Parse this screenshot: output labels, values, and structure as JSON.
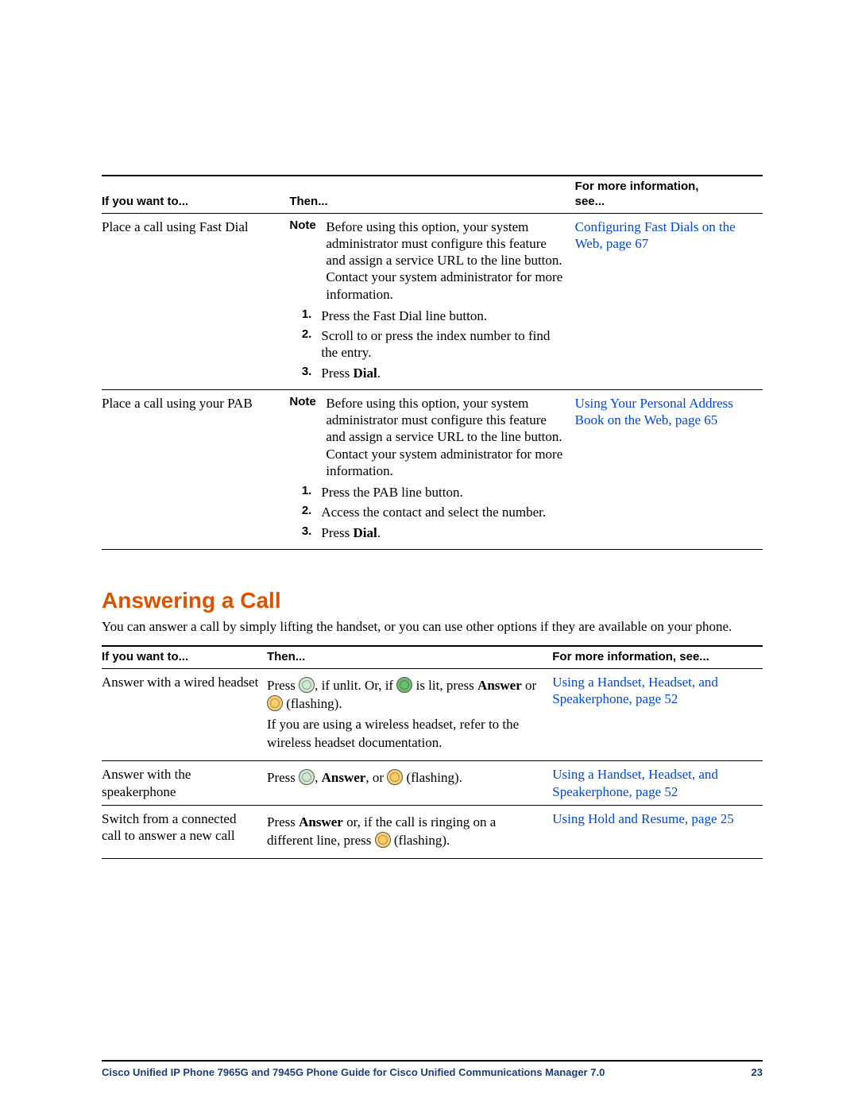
{
  "table1": {
    "headers": {
      "c1": "If you want to...",
      "c2": "Then...",
      "c3_line1": "For more information,",
      "c3_line2": "see..."
    },
    "rows": [
      {
        "want": "Place a call using Fast Dial",
        "note_label": "Note",
        "note": "Before using this option, your system administrator must configure this feature and assign a service URL to the line button. Contact your system administrator for more information.",
        "steps": [
          {
            "num": "1.",
            "text": "Press the Fast Dial line button."
          },
          {
            "num": "2.",
            "text": "Scroll to or press the index number to find the entry."
          },
          {
            "num": "3.",
            "pre": "Press ",
            "bold": "Dial",
            "post": "."
          }
        ],
        "link": "Configuring Fast Dials on the Web, page 67"
      },
      {
        "want": "Place a call using your PAB",
        "note_label": "Note",
        "note": "Before using this option, your system administrator must configure this feature and assign a service URL to the line button. Contact your system administrator for more information.",
        "steps": [
          {
            "num": "1.",
            "text": "Press the PAB line button."
          },
          {
            "num": "2.",
            "text": "Access the contact and select the number."
          },
          {
            "num": "3.",
            "pre": "Press ",
            "bold": "Dial",
            "post": "."
          }
        ],
        "link": "Using Your Personal Address Book on the Web, page 65"
      }
    ]
  },
  "section": {
    "heading": "Answering a Call",
    "intro": "You can answer a call by simply lifting the handset, or you can use other options if they are available on your phone."
  },
  "table2": {
    "headers": {
      "c1": "If you want to...",
      "c2": "Then...",
      "c3": "For more information, see..."
    },
    "rows": [
      {
        "want": "Answer with a wired headset",
        "then": {
          "p1_a": "Press ",
          "p1_b": ", if unlit. Or, if ",
          "p1_c": " is lit, press ",
          "answer": "Answer",
          "p1_d": " or ",
          "p1_e": " (flashing).",
          "p2": "If you are using a wireless headset, refer to the wireless headset documentation."
        },
        "link": "Using a Handset, Headset, and Speakerphone, page 52"
      },
      {
        "want": "Answer with the speakerphone",
        "then": {
          "a": "Press ",
          "b": ", ",
          "answer": "Answer",
          "c": ", or ",
          "d": " (flashing)."
        },
        "link": "Using a Handset, Headset, and Speakerphone, page 52"
      },
      {
        "want": "Switch from a connected call to answer a new call",
        "then": {
          "a": "Press ",
          "answer": "Answer",
          "b": " or, if the call is ringing on a different line, press ",
          "c": " (flashing)."
        },
        "link": "Using Hold and Resume, page 25"
      }
    ]
  },
  "footer": {
    "title": "Cisco Unified IP Phone 7965G and 7945G Phone Guide for Cisco Unified Communications Manager 7.0",
    "page": "23"
  }
}
